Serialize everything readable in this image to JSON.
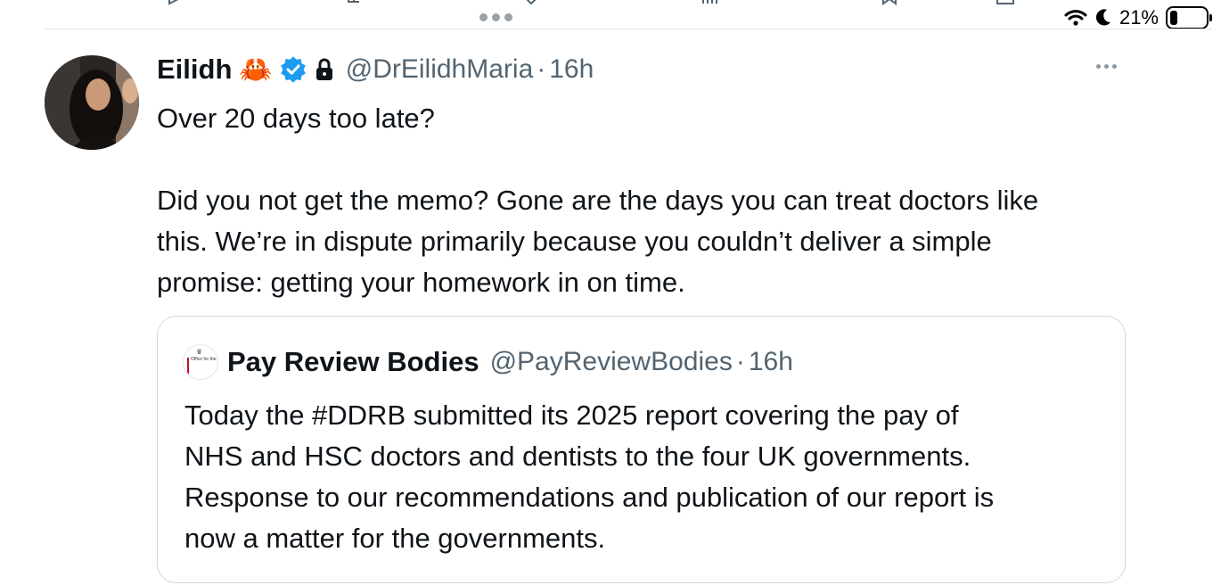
{
  "status_bar": {
    "battery_text": "21%",
    "battery_level": 0.21
  },
  "tweet": {
    "display_name": "Eilidh",
    "name_emoji": "🦀",
    "handle": "@DrEilidhMaria",
    "separator": "·",
    "time": "16h",
    "text_lines": [
      "Over 20 days too late?",
      "",
      "Did you not get the memo? Gone are the days you can treat doctors like",
      "this. We’re in dispute primarily because you couldn’t deliver a simple",
      "promise: getting your homework in on time."
    ],
    "icons": [
      "verified-badge-icon",
      "lock-icon",
      "more-options-icon"
    ]
  },
  "quoted_tweet": {
    "logo_text": "Office for the Pay Review Bodies",
    "display_name": "Pay Review Bodies",
    "handle": "@PayReviewBodies",
    "separator": "·",
    "time": "16h",
    "text_lines": [
      "Today the #DDRB submitted its 2025 report covering the pay of",
      "NHS and HSC doctors and dentists to the four UK governments.",
      "Response to our recommendations and publication of our report is",
      "now a matter for the governments."
    ]
  },
  "colors": {
    "text": "#0f1419",
    "secondary": "#536471",
    "verified": "#1d9bf0",
    "border": "#cfd9de"
  }
}
